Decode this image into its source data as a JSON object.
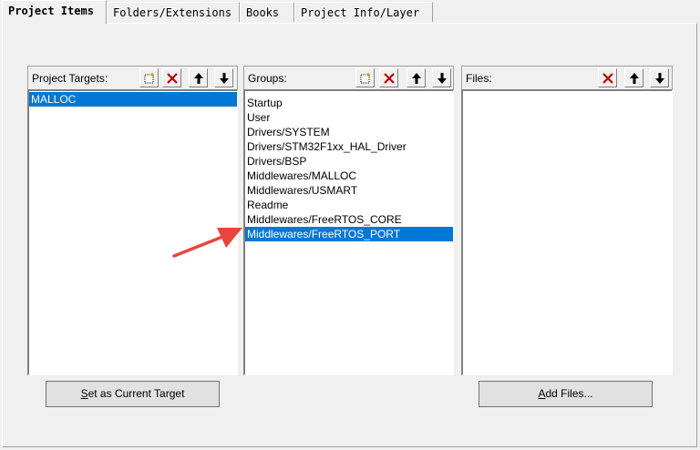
{
  "tabs": [
    {
      "label": "Project Items"
    },
    {
      "label": "Folders/Extensions"
    },
    {
      "label": "Books"
    },
    {
      "label": "Project Info/Layer"
    }
  ],
  "targets": {
    "label": "Project Targets:",
    "items": [
      "MALLOC"
    ],
    "selected": 0
  },
  "groups": {
    "label": "Groups:",
    "items": [
      "Startup",
      "User",
      "Drivers/SYSTEM",
      "Drivers/STM32F1xx_HAL_Driver",
      "Drivers/BSP",
      "Middlewares/MALLOC",
      "Middlewares/USMART",
      "Readme",
      "Middlewares/FreeRTOS_CORE",
      "Middlewares/FreeRTOS_PORT"
    ],
    "selected": 9
  },
  "files": {
    "label": "Files:",
    "items": []
  },
  "buttons": {
    "set_target_prefix": "S",
    "set_target_rest": "et as Current Target",
    "add_files_prefix": "A",
    "add_files_rest": "dd Files..."
  },
  "icons": {
    "new": "new-item-icon",
    "delete": "delete-icon",
    "up": "move-up-icon",
    "down": "move-down-icon"
  },
  "colors": {
    "selection": "#0078d7",
    "delete_red": "#c00000",
    "annotation_arrow": "#e8453c"
  }
}
